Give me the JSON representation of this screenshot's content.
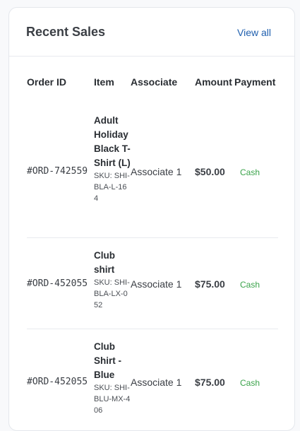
{
  "card": {
    "title": "Recent Sales",
    "view_all_label": "View all"
  },
  "table": {
    "headers": [
      "Order ID",
      "Item",
      "Associate",
      "Amount",
      "Payment"
    ],
    "rows": [
      {
        "order_id": "#ORD-742559",
        "item_name": "Adult Holiday Black T-Shirt (L)",
        "item_sku": "SKU: SHI-BLA-L-164",
        "associate": "Associate 1",
        "amount": "$50.00",
        "payment": "Cash"
      },
      {
        "order_id": "#ORD-452055",
        "item_name": "Club shirt",
        "item_sku": "SKU: SHI-BLA-LX-052",
        "associate": "Associate 1",
        "amount": "$75.00",
        "payment": "Cash"
      },
      {
        "order_id": "#ORD-452055",
        "item_name": "Club Shirt - Blue",
        "item_sku": "SKU: SHI-BLU-MX-406",
        "associate": "Associate 1",
        "amount": "$75.00",
        "payment": "Cash"
      }
    ]
  },
  "colors": {
    "link": "#1f5fae",
    "payment_cash": "#3aa34a"
  }
}
